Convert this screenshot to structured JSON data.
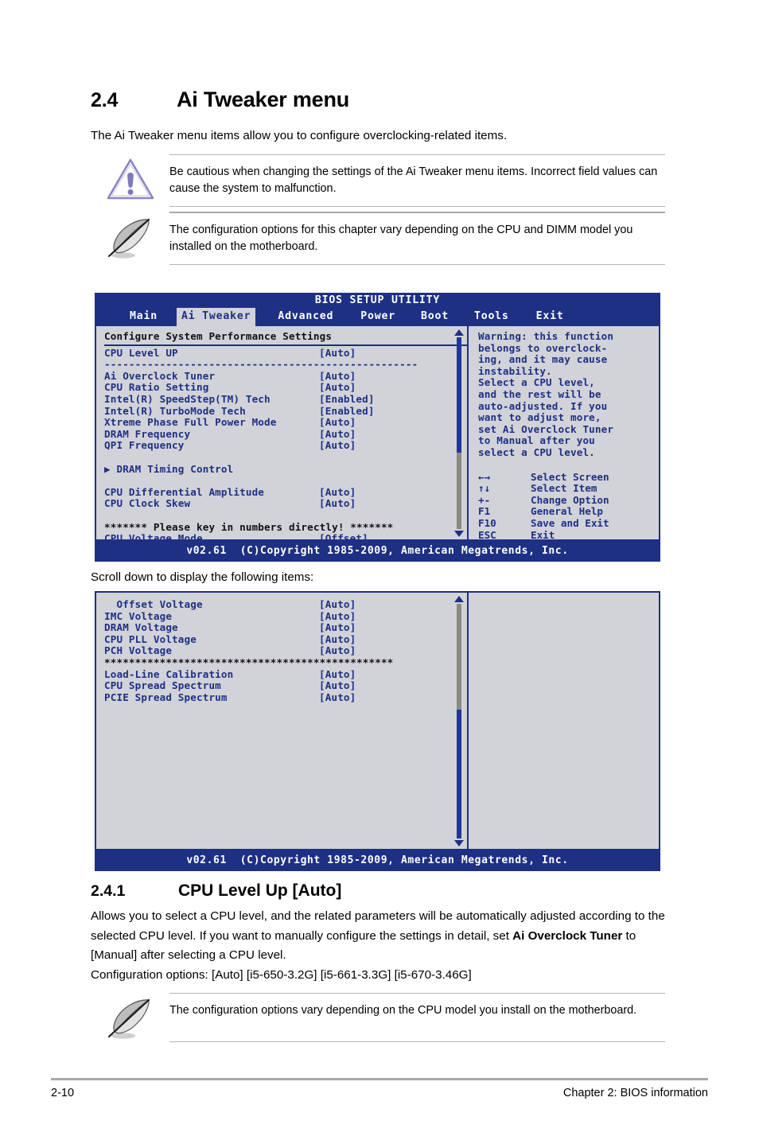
{
  "section": {
    "number": "2.4",
    "title": "Ai Tweaker menu",
    "intro": "The Ai Tweaker menu items allow you to configure overclocking-related items."
  },
  "warning_box": {
    "icon": "warning-triangle-icon",
    "text": "Be cautious when changing the settings of the Ai Tweaker menu items. Incorrect field values can cause the system to malfunction."
  },
  "note_box_1": {
    "icon": "note-quill-icon",
    "text": "The configuration options for this chapter vary depending on the CPU and DIMM model you installed on the motherboard."
  },
  "bios_screen_1": {
    "title": "BIOS SETUP UTILITY",
    "tabs": [
      {
        "label": "Main",
        "active": false
      },
      {
        "label": "Ai Tweaker",
        "active": true
      },
      {
        "label": "Advanced",
        "active": false
      },
      {
        "label": "Power",
        "active": false
      },
      {
        "label": "Boot",
        "active": false
      },
      {
        "label": "Tools",
        "active": false
      },
      {
        "label": "Exit",
        "active": false
      }
    ],
    "heading": "Configure System Performance Settings",
    "items": [
      {
        "label": "CPU Level UP",
        "value": "[Auto]"
      },
      {
        "label": "---------------------------------------------------",
        "value": "",
        "kind": "separator"
      },
      {
        "label": "Ai Overclock Tuner",
        "value": "[Auto]"
      },
      {
        "label": "CPU Ratio Setting",
        "value": "[Auto]"
      },
      {
        "label": "Intel(R) SpeedStep(TM) Tech",
        "value": "[Enabled]"
      },
      {
        "label": "Intel(R) TurboMode Tech",
        "value": "[Enabled]"
      },
      {
        "label": "Xtreme Phase Full Power Mode",
        "value": "[Auto]"
      },
      {
        "label": "DRAM Frequency",
        "value": "[Auto]"
      },
      {
        "label": "QPI Frequency",
        "value": "[Auto]"
      },
      {
        "label": "",
        "value": "",
        "kind": "blank"
      },
      {
        "label": "▶ DRAM Timing Control",
        "value": "",
        "kind": "submenu"
      },
      {
        "label": "",
        "value": "",
        "kind": "blank"
      },
      {
        "label": "CPU Differential Amplitude",
        "value": "[Auto]"
      },
      {
        "label": "CPU Clock Skew",
        "value": "[Auto]"
      },
      {
        "label": "",
        "value": "",
        "kind": "blank"
      },
      {
        "label": "******* Please key in numbers directly! *******",
        "value": "",
        "kind": "banner"
      },
      {
        "label": "CPU Voltage Mode",
        "value": "[Offset]"
      }
    ],
    "help_text": "Warning: this function\nbelongs to overclock-\ning, and it may cause\ninstability.\nSelect a CPU level,\nand the rest will be\nauto-adjusted. If you\nwant to adjust more,\nset Ai Overclock Tuner\nto Manual after you\nselect a CPU level.",
    "key_legend": [
      {
        "key": "←→",
        "action": "Select Screen"
      },
      {
        "key": "↑↓",
        "action": "Select Item"
      },
      {
        "key": "+-",
        "action": "Change Option"
      },
      {
        "key": "F1",
        "action": "General Help"
      },
      {
        "key": "F10",
        "action": "Save and Exit"
      },
      {
        "key": "ESC",
        "action": "Exit"
      }
    ],
    "footer": "v02.61  (C)Copyright 1985-2009, American Megatrends, Inc.",
    "scrollbar": {
      "thumb_top_percent": 0,
      "thumb_height_percent": 60
    }
  },
  "scroll_note": "Scroll down to display the following items:",
  "bios_screen_2": {
    "items": [
      {
        "label": "  Offset Voltage",
        "value": "[Auto]"
      },
      {
        "label": "IMC Voltage",
        "value": "[Auto]"
      },
      {
        "label": "DRAM Voltage",
        "value": "[Auto]"
      },
      {
        "label": "CPU PLL Voltage",
        "value": "[Auto]"
      },
      {
        "label": "PCH Voltage",
        "value": "[Auto]"
      },
      {
        "label": "***********************************************",
        "value": "",
        "kind": "banner"
      },
      {
        "label": "Load-Line Calibration",
        "value": "[Auto]"
      },
      {
        "label": "CPU Spread Spectrum",
        "value": "[Auto]"
      },
      {
        "label": "PCIE Spread Spectrum",
        "value": "[Auto]"
      }
    ],
    "footer": "v02.61  (C)Copyright 1985-2009, American Megatrends, Inc.",
    "scrollbar": {
      "thumb_top_percent": 45,
      "thumb_height_percent": 55
    }
  },
  "subsection": {
    "number": "2.4.1",
    "title": "CPU Level Up [Auto]",
    "paragraph_before_bold": "Allows you to select a CPU level, and the related parameters will be automatically adjusted according to the selected CPU level. If you want to manually configure the settings in detail, set ",
    "paragraph_bold": "Ai Overclock Tuner",
    "paragraph_after_bold": " to [Manual] after selecting a CPU level.",
    "config_options_line": "Configuration options: [Auto] [i5-650-3.2G] [i5-661-3.3G] [i5-670-3.46G]"
  },
  "note_box_2": {
    "icon": "note-quill-icon",
    "text": "The configuration options vary depending on the CPU model you install on the motherboard."
  },
  "footer": {
    "page_number": "2-10",
    "chapter": "Chapter 2: BIOS information"
  },
  "colors": {
    "bios_blue": "#1e3084",
    "bios_panel": "#d2d2d9",
    "warning_icon": "#8a86c4",
    "rule_gray": "#b5b5b5"
  }
}
